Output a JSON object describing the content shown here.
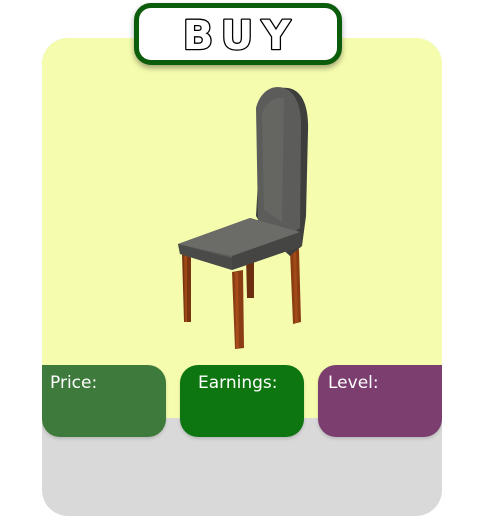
{
  "banner": {
    "title": "BUY",
    "letters": [
      "B",
      "U",
      "Y"
    ]
  },
  "item": {
    "icon": "chair-icon"
  },
  "stats": {
    "price_label": "Price:",
    "earnings_label": "Earnings:",
    "level_label": "Level:"
  },
  "colors": {
    "card_top": "#f5fcad",
    "card_bottom": "#d9d9d9",
    "banner_border": "#0b5c0b",
    "price": "#3f7a3d",
    "earnings": "#0e7610",
    "level": "#7b3e6e"
  }
}
